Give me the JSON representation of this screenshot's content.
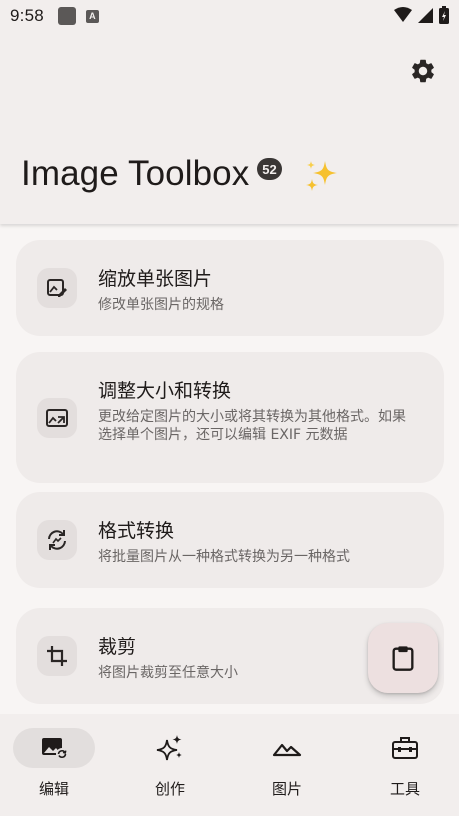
{
  "status_bar": {
    "time": "9:58",
    "notification_letter": "A"
  },
  "header": {
    "app_title": "Image Toolbox",
    "version_badge": "52"
  },
  "tools": [
    {
      "title": "缩放单张图片",
      "description": "修改单张图片的规格",
      "icon": "image-edit-icon"
    },
    {
      "title": "调整大小和转换",
      "description": "更改给定图片的大小或将其转换为其他格式。如果选择单个图片，还可以编辑 EXIF 元数据",
      "icon": "image-resize-icon"
    },
    {
      "title": "格式转换",
      "description": "将批量图片从一种格式转换为另一种格式",
      "icon": "format-convert-icon"
    },
    {
      "title": "裁剪",
      "description": "将图片裁剪至任意大小",
      "icon": "crop-icon"
    }
  ],
  "bottom_nav": [
    {
      "label": "编辑",
      "icon": "image-sync-icon",
      "active": true
    },
    {
      "label": "创作",
      "icon": "sparkles-icon",
      "active": false
    },
    {
      "label": "图片",
      "icon": "landscape-icon",
      "active": false
    },
    {
      "label": "工具",
      "icon": "toolbox-icon",
      "active": false
    }
  ],
  "colors": {
    "background": "#f8f5f4",
    "card": "#efebea",
    "accent_fab": "#ede0e0",
    "text": "#1f1b1a"
  }
}
